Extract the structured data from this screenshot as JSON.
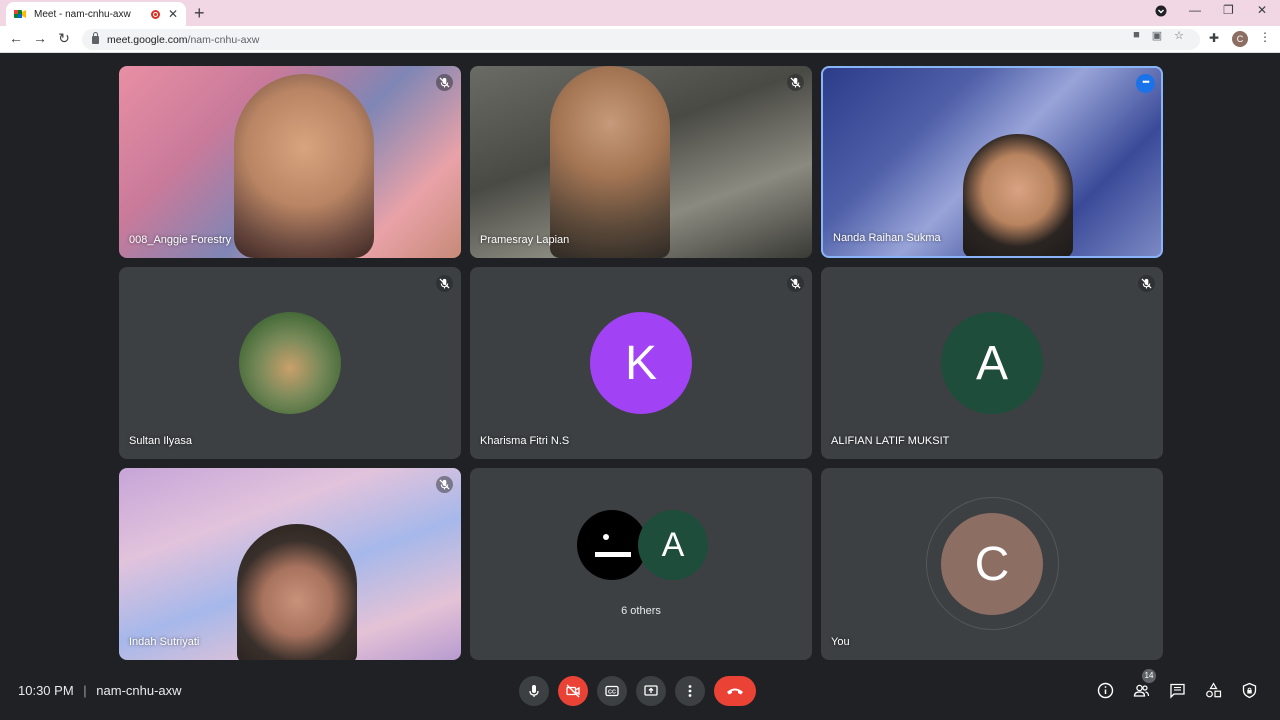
{
  "browser": {
    "tab_title": "Meet - nam-cnhu-axw",
    "url_host": "meet.google.com",
    "url_path": "/nam-cnhu-axw",
    "profile_initial": "C"
  },
  "participants": [
    {
      "name": "008_Anggie Forestry",
      "type": "video",
      "muted": true
    },
    {
      "name": "Pramesray Lapian",
      "type": "video",
      "muted": true
    },
    {
      "name": "Nanda Raihan Sukma",
      "type": "video",
      "muted": false,
      "active": true
    },
    {
      "name": "Sultan Ilyasa",
      "type": "photo",
      "muted": true
    },
    {
      "name": "Kharisma Fitri N.S",
      "type": "initial",
      "initial": "K",
      "color": "#a142f4",
      "muted": true
    },
    {
      "name": "ALIFIAN LATIF MUKSIT",
      "type": "initial",
      "initial": "A",
      "color": "#1e4d3b",
      "muted": true
    },
    {
      "name": "Indah Sutriyati",
      "type": "video",
      "muted": true
    },
    {
      "name": "6 others",
      "type": "group",
      "initial": "A",
      "color": "#1e4d3b"
    },
    {
      "name": "You",
      "type": "initial",
      "initial": "C",
      "color": "#8d6e63",
      "muted": false
    }
  ],
  "footer": {
    "time": "10:30 PM",
    "meeting_code": "nam-cnhu-axw",
    "people_count": "14"
  },
  "colors": {
    "accent": "#1a73e8",
    "danger": "#ea4335",
    "tile": "#3c4043",
    "bg": "#202124"
  }
}
